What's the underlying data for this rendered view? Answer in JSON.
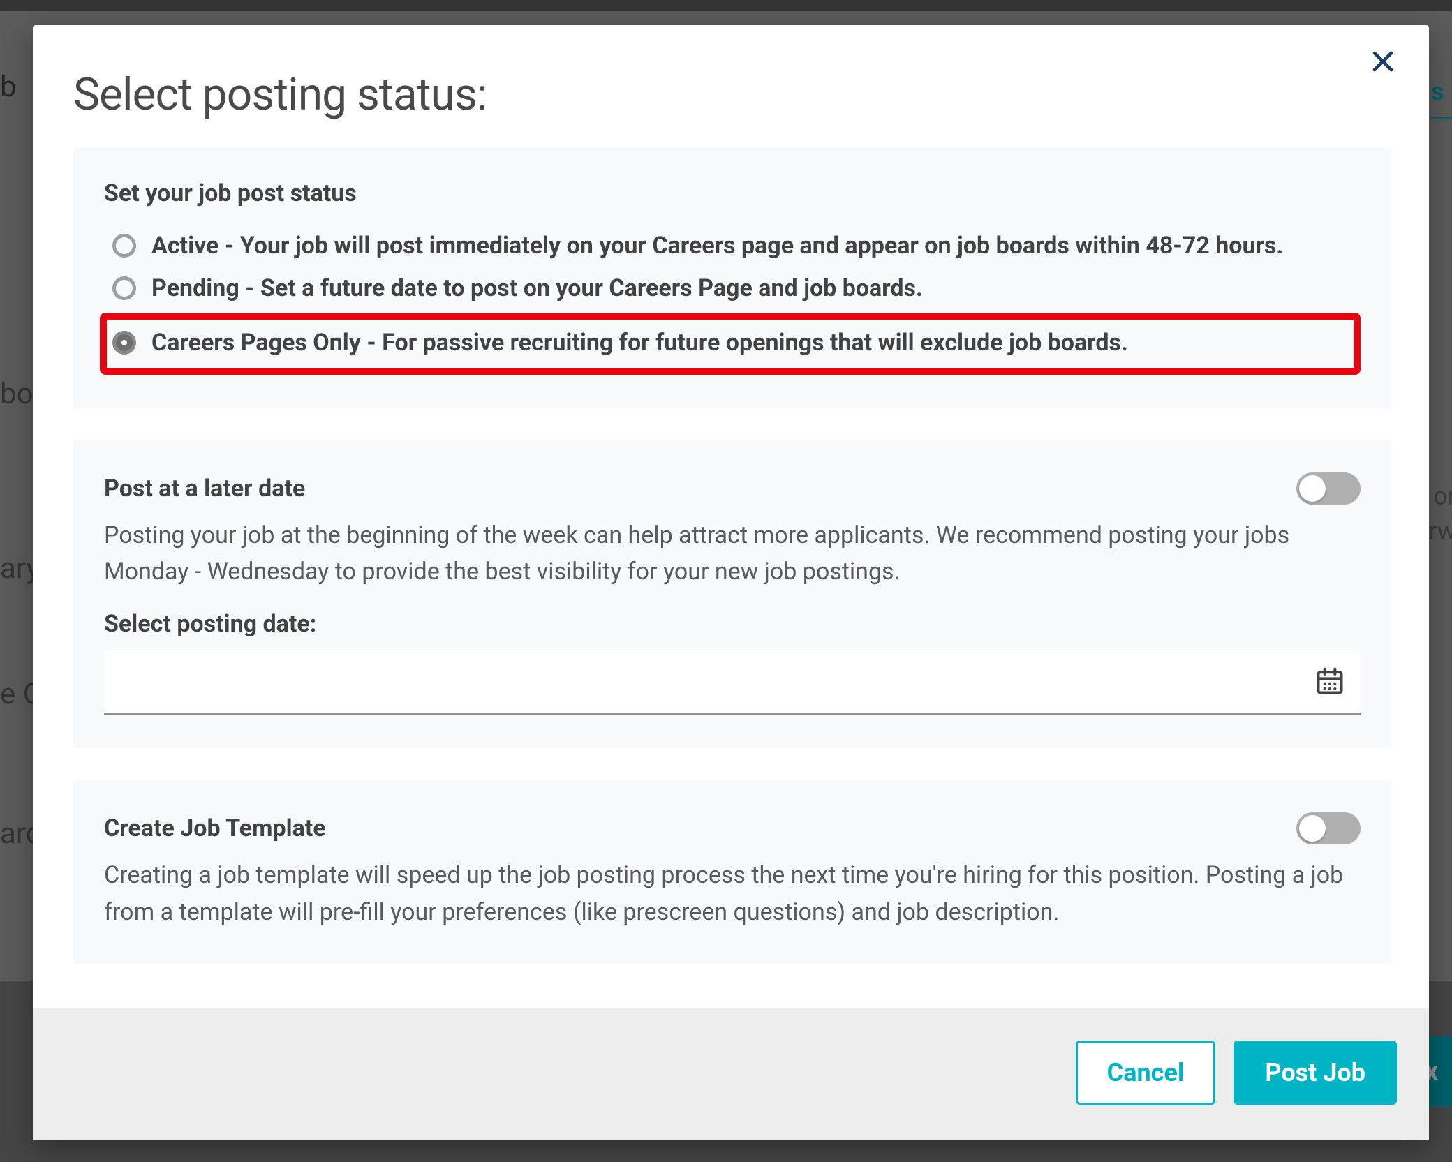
{
  "modal": {
    "title": "Select posting status:"
  },
  "status_panel": {
    "heading": "Set your job post status",
    "options": {
      "active": "Active - Your job will post immediately on your Careers page and appear on job boards within 48-72 hours.",
      "pending": "Pending - Set a future date to post on your Careers Page and job boards.",
      "careers_only": "Careers Pages Only - For passive recruiting for future openings that will exclude job boards."
    },
    "selected": "careers_only"
  },
  "later_panel": {
    "heading": "Post at a later date",
    "description": "Posting your job at the beginning of the week can help attract more applicants. We recommend posting your jobs Monday - Wednesday to provide the best visibility for your new job postings.",
    "field_label": "Select posting date:",
    "date_value": "",
    "toggle_on": false
  },
  "template_panel": {
    "heading": "Create Job Template",
    "description": "Creating a job template will speed up the job posting process the next time you're hiring for this position. Posting a job from a template will pre-fill your preferences (like prescreen questions) and job description.",
    "toggle_on": false
  },
  "footer": {
    "cancel": "Cancel",
    "submit": "Post Job"
  },
  "background": {
    "tab_fragment": "b",
    "section1": "bo",
    "section2": "ary",
    "section3": "e O",
    "section4": "ard",
    "teal_fragment": "s",
    "right1": "or",
    "right2": "rw",
    "next_fragment": "ex"
  }
}
